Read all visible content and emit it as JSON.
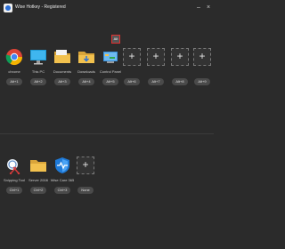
{
  "window": {
    "title": "Wise Hotkey - Registered",
    "minimize_glyph": "–",
    "close_glyph": "×"
  },
  "row1": [
    {
      "label": "chrome",
      "hotkey": "Alt+1",
      "icon": "chrome-icon"
    },
    {
      "label": "This PC",
      "hotkey": "Alt+2",
      "icon": "monitor-icon"
    },
    {
      "label": "Documents",
      "hotkey": "Alt+3",
      "icon": "folder-icon"
    },
    {
      "label": "Downloads",
      "hotkey": "Alt+4",
      "icon": "folder-icon"
    },
    {
      "label": "Control Panel",
      "hotkey": "Alt+5",
      "icon": "control-panel-icon",
      "highlight": "Alt"
    },
    {
      "label": "",
      "hotkey": "Alt+6",
      "empty": true
    },
    {
      "label": "",
      "hotkey": "Alt+7",
      "empty": true
    },
    {
      "label": "",
      "hotkey": "Alt+8",
      "empty": true
    },
    {
      "label": "",
      "hotkey": "Alt+9",
      "empty": true
    }
  ],
  "row2": [
    {
      "label": "Snipping Tool",
      "hotkey": "Ctrl+1",
      "icon": "scissors-icon"
    },
    {
      "label": "Server 2008",
      "hotkey": "Ctrl+2",
      "icon": "folder-icon"
    },
    {
      "label": "Wise Care 365",
      "hotkey": "Ctrl+3",
      "icon": "shield-icon"
    },
    {
      "label": "",
      "hotkey": "None",
      "empty": true
    }
  ],
  "plus_glyph": "+"
}
